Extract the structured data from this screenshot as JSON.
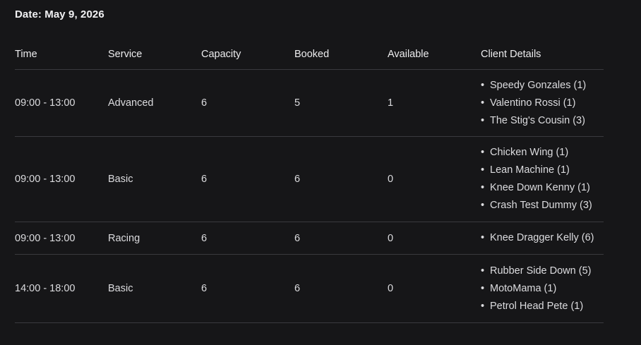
{
  "date_heading": "Date: May 9, 2026",
  "columns": {
    "time": "Time",
    "service": "Service",
    "capacity": "Capacity",
    "booked": "Booked",
    "available": "Available",
    "client_details": "Client Details"
  },
  "rows": [
    {
      "time": "09:00 - 13:00",
      "service": "Advanced",
      "capacity": "6",
      "booked": "5",
      "available": "1",
      "clients": [
        "Speedy Gonzales (1)",
        "Valentino Rossi (1)",
        "The Stig's Cousin (3)"
      ]
    },
    {
      "time": "09:00 - 13:00",
      "service": "Basic",
      "capacity": "6",
      "booked": "6",
      "available": "0",
      "clients": [
        "Chicken Wing (1)",
        "Lean Machine (1)",
        "Knee Down Kenny (1)",
        "Crash Test Dummy (3)"
      ]
    },
    {
      "time": "09:00 - 13:00",
      "service": "Racing",
      "capacity": "6",
      "booked": "6",
      "available": "0",
      "clients": [
        "Knee Dragger Kelly (6)"
      ]
    },
    {
      "time": "14:00 - 18:00",
      "service": "Basic",
      "capacity": "6",
      "booked": "6",
      "available": "0",
      "clients": [
        "Rubber Side Down (5)",
        "MotoMama (1)",
        "Petrol Head Pete (1)"
      ]
    }
  ]
}
